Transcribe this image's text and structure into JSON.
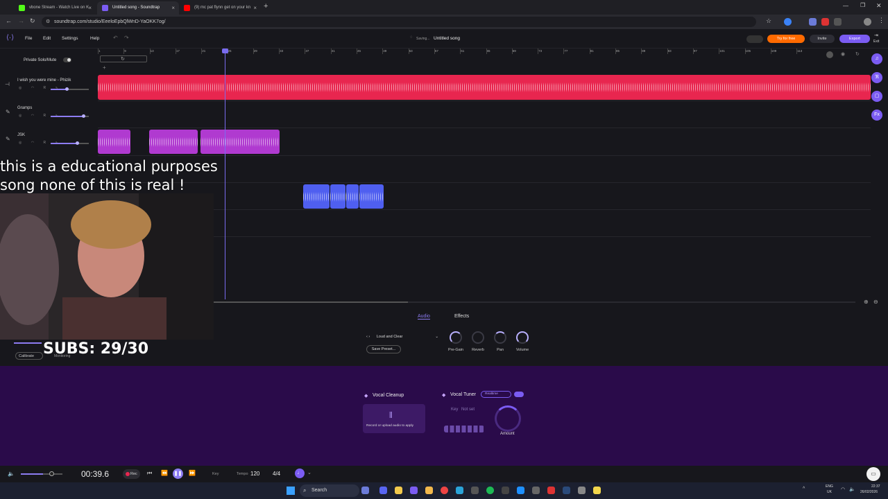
{
  "browser": {
    "tabs": [
      {
        "label": "vbone Stream - Watch Live on K",
        "color": "#53fc18"
      },
      {
        "label": "Untitled song - Soundtrap",
        "color": "#7b5cf2"
      },
      {
        "label": "(9) mc pat flynn get on your kn",
        "color": "#ff0000"
      }
    ],
    "new_tab": "+",
    "url": "soundtrap.com/studio/EeeloEpbQlWnD-YaOKK7og/"
  },
  "app": {
    "menu": {
      "file": "File",
      "edit": "Edit",
      "settings": "Settings",
      "help": "Help"
    },
    "status": "Saving...",
    "song_title": "Untitled song",
    "try_free": "Try for free",
    "invite": "Invite",
    "export": "Export",
    "exit": "Exit",
    "private_solo": "Private Solo/Mute",
    "add_track": "+"
  },
  "ruler": [
    "1",
    "9",
    "13",
    "17",
    "21",
    "25",
    "29",
    "33",
    "37",
    "41",
    "45",
    "49",
    "53",
    "57",
    "61",
    "65",
    "69",
    "73",
    "77",
    "81",
    "85",
    "89",
    "93",
    "97",
    "101",
    "105",
    "109",
    "113"
  ],
  "tracks": [
    {
      "name": "I wish you were mine - Phizik",
      "color": "#e8264f"
    },
    {
      "name": "Gramps",
      "color": "#a33ac9"
    },
    {
      "name": "JSK",
      "color": "#b03ad0"
    },
    {
      "name": "",
      "color": "#4f5ff0"
    }
  ],
  "overlay": {
    "caption_line1": "this is a educational purposes",
    "caption_line2": "song none of this is real !",
    "subs": "SUBS: 29/30"
  },
  "bottom_panel": {
    "tab_audio": "Audio",
    "tab_effects": "Effects",
    "preset": "Loud and Clear",
    "save_preset": "Save Preset...",
    "knobs": [
      "Pre-Gain",
      "Reverb",
      "Pan",
      "Volume"
    ],
    "calibrate": "Calibrate",
    "monitoring": "Monitoring"
  },
  "vocal": {
    "cleanup_title": "Vocal Cleanup",
    "cleanup_hint": "Record or upload audio to apply",
    "tuner_title": "Vocal Tuner",
    "tuner_mode": "Realtime",
    "key_label": "Key",
    "key_value": "Not set",
    "amount": "Amount"
  },
  "transport": {
    "time": "00:39.6",
    "rec": "Rec",
    "key": "Key",
    "tempo_label": "Tempo",
    "tempo": "120",
    "signature": "4/4"
  },
  "taskbar": {
    "search": "Search",
    "lang": "ENG",
    "region": "UK",
    "clock": "22:37",
    "date": "26/02/2026"
  }
}
